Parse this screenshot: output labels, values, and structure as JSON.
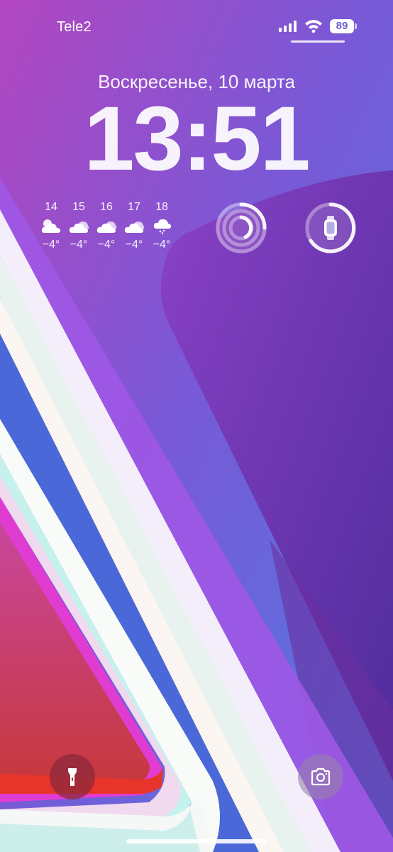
{
  "status_bar": {
    "carrier": "Tele2",
    "battery": "89"
  },
  "lock_screen": {
    "date": "Воскресенье, 10 марта",
    "time": "13:51"
  },
  "weather": {
    "hours": [
      {
        "hour": "14",
        "icon": "partly-cloudy-icon",
        "temp": "−4°"
      },
      {
        "hour": "15",
        "icon": "cloudy-icon",
        "temp": "−4°"
      },
      {
        "hour": "16",
        "icon": "cloudy-icon",
        "temp": "−4°"
      },
      {
        "hour": "17",
        "icon": "cloudy-icon",
        "temp": "−4°"
      },
      {
        "hour": "18",
        "icon": "snow-icon",
        "temp": "−4°"
      }
    ]
  },
  "widgets": {
    "activity_icon": "activity-rings-icon",
    "watch_battery_icon": "apple-watch-icon"
  },
  "controls": {
    "flashlight_icon": "flashlight-icon",
    "camera_icon": "camera-icon"
  },
  "colors": {
    "wallpaper_purple": "#8a4fc9",
    "wallpaper_blue": "#5b59cf",
    "stripe_pink": "#e23fd0",
    "stripe_red": "#e34040"
  }
}
